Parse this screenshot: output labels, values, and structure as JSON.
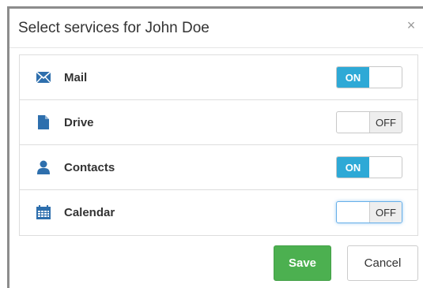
{
  "dialog": {
    "title": "Select services for John Doe",
    "close_icon": "close-icon"
  },
  "services": [
    {
      "label": "Mail",
      "icon": "envelope-icon",
      "state": "ON"
    },
    {
      "label": "Drive",
      "icon": "file-icon",
      "state": "OFF"
    },
    {
      "label": "Contacts",
      "icon": "user-icon",
      "state": "ON"
    },
    {
      "label": "Calendar",
      "icon": "calendar-icon",
      "state": "OFF"
    }
  ],
  "toggle_labels": {
    "on": "ON",
    "off": "OFF"
  },
  "footer": {
    "save_label": "Save",
    "cancel_label": "Cancel"
  },
  "colors": {
    "toggle_on": "#2ea9d6",
    "icon": "#2e6fad",
    "save": "#4cb050"
  }
}
